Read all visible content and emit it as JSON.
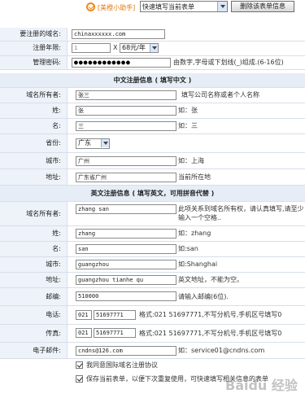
{
  "topbar": {
    "helper_label": "[美橙小助手]",
    "form_select": "快速填写当前表单",
    "delete_button": "删除该表单信息"
  },
  "domain_row": {
    "label": "要注册的域名:",
    "value": "chinaxxxxxx.com"
  },
  "years_row": {
    "label": "注册年限:",
    "years": "1",
    "times": "X",
    "price_option": "68元/年"
  },
  "password_row": {
    "label": "管理密码:",
    "dots": "●●●●●●●●●●●●",
    "hint": "由数字,字母或下划线(_)组成.(6-16位)"
  },
  "cn_section": {
    "title": "中文注册信息 ( 填写中文 )",
    "owner": {
      "label": "域名所有者:",
      "value": "张三",
      "hint": "填写公司名称或者个人名称"
    },
    "surname": {
      "label": "姓:",
      "value": "张",
      "hint": "如：张"
    },
    "given": {
      "label": "名:",
      "value": "三",
      "hint": "如：三"
    },
    "province": {
      "label": "省份:",
      "value": "广东"
    },
    "city": {
      "label": "城市:",
      "value": "广州",
      "hint": "如：上海"
    },
    "address": {
      "label": "地址:",
      "value": "广东省广州",
      "hint": "当前所在地"
    }
  },
  "en_section": {
    "title": "英文注册信息 ( 填写英文，可用拼音代替 )",
    "owner": {
      "label": "域名所有者:",
      "value": "zhang san",
      "hint": "此项关系到域名所有权，请认真填写,请至少输入一个空格.."
    },
    "surname": {
      "label": "姓:",
      "value": "zhang",
      "hint": "如：zhang"
    },
    "given": {
      "label": "名:",
      "value": "san",
      "hint": "如:san"
    },
    "city": {
      "label": "城市:",
      "value": "guangzhou",
      "hint": "如:Shanghai"
    },
    "address": {
      "label": "地址:",
      "value": "guangzhou tianhe qu",
      "hint": "英文地址，不能为空。"
    },
    "postcode": {
      "label": "邮编:",
      "value": "510000",
      "hint": "请输入邮编(6位)."
    },
    "phone": {
      "label": "电话:",
      "area": "021",
      "number": "51697771",
      "hint": "格式:021 51697771,不写分机号,手机区号填写0"
    },
    "fax": {
      "label": "传真:",
      "area": "021",
      "number": "51697771",
      "hint": "格式:021 51697771,不写分机号,手机区号填写0"
    },
    "email": {
      "label": "电子邮件:",
      "value": "cndns@126.com",
      "hint": "如：service01@cndns.com"
    }
  },
  "agree": {
    "label": "我同意国际域名注册协议"
  },
  "save": {
    "label": "保存当前表单，以便下次重复使用，可快速填写相关信息的表单"
  },
  "watermark": "Baidu 经验"
}
